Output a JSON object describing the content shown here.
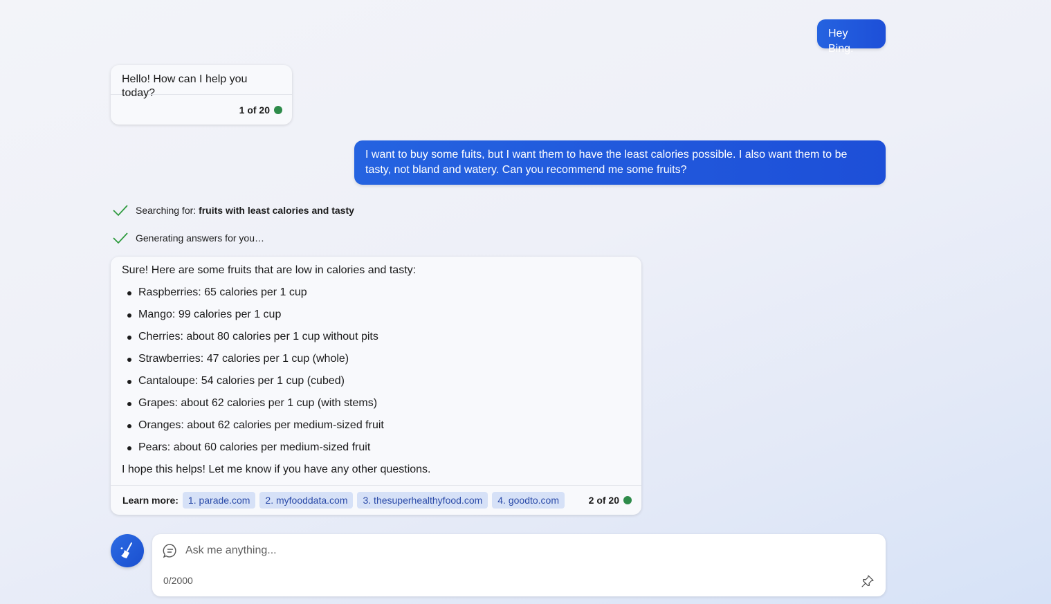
{
  "conversation": {
    "user_messages": [
      "Hey Bing.",
      "I want to buy some fuits, but I want them to have the least calories possible. I also want them to be tasty, not bland and watery. Can you recommend me some fruits?"
    ],
    "bot_greeting": {
      "text": "Hello! How can I help you today?",
      "counter": "1 of 20"
    },
    "status": {
      "searching_prefix": "Searching for: ",
      "searching_query": "fruits with least calories and tasty",
      "generating": "Generating answers for you…"
    },
    "bot_answer": {
      "intro": "Sure! Here are some fruits that are low in calories and tasty:",
      "items": [
        "Raspberries: 65 calories per 1 cup",
        "Mango: 99 calories per 1 cup",
        "Cherries: about 80 calories per 1 cup without pits",
        "Strawberries: 47 calories per 1 cup (whole)",
        "Cantaloupe: 54 calories per 1 cup (cubed)",
        "Grapes: about 62 calories per 1 cup (with stems)",
        "Oranges: about 62 calories per medium-sized fruit",
        "Pears: about 60 calories per medium-sized fruit"
      ],
      "outro": "I hope this helps! Let me know if you have any other questions.",
      "learn_more_label": "Learn more:",
      "sources": [
        "1. parade.com",
        "2. myfooddata.com",
        "3. thesuperhealthyfood.com",
        "4. goodto.com"
      ],
      "counter": "2 of 20"
    }
  },
  "composer": {
    "placeholder": "Ask me anything...",
    "char_count": "0/2000"
  },
  "colors": {
    "user_bubble": "#1d4fd8",
    "status_dot": "#2e8b4a",
    "check": "#2e9b3e",
    "chip_bg": "#d6e1f7"
  }
}
